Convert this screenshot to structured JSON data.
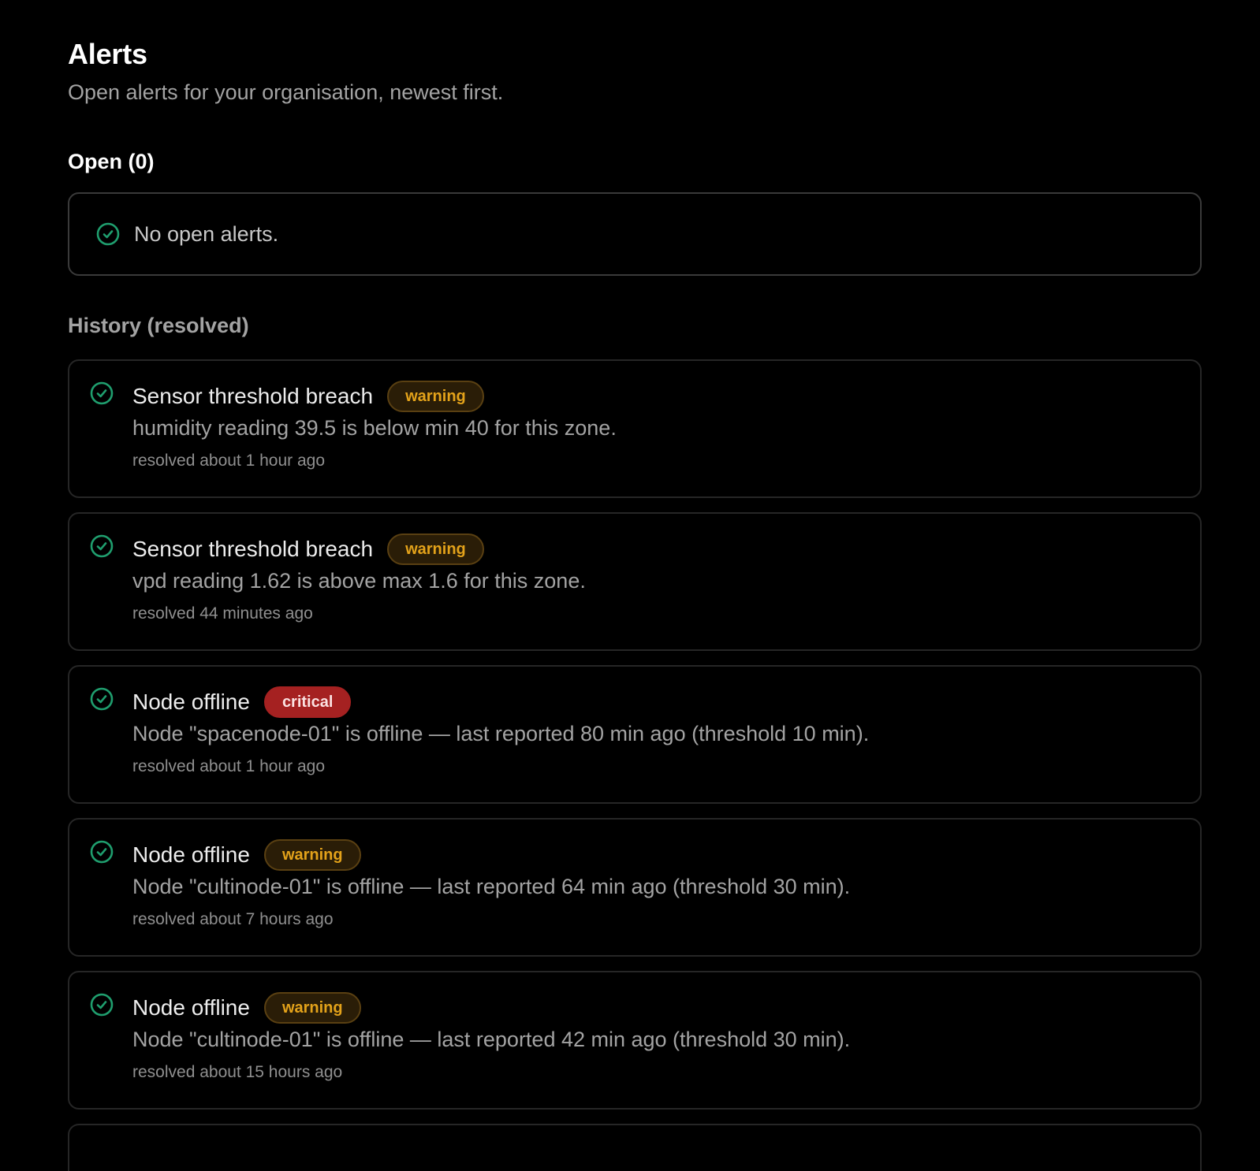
{
  "header": {
    "title": "Alerts",
    "subtitle": "Open alerts for your organisation, newest first."
  },
  "open": {
    "heading": "Open (0)",
    "empty_text": "No open alerts."
  },
  "history": {
    "heading": "History (resolved)",
    "items": [
      {
        "title": "Sensor threshold breach",
        "severity": "warning",
        "description": "humidity reading 39.5 is below min 40 for this zone.",
        "resolved": "resolved about 1 hour ago"
      },
      {
        "title": "Sensor threshold breach",
        "severity": "warning",
        "description": "vpd reading 1.62 is above max 1.6 for this zone.",
        "resolved": "resolved 44 minutes ago"
      },
      {
        "title": "Node offline",
        "severity": "critical",
        "description": "Node \"spacenode-01\" is offline — last reported 80 min ago (threshold 10 min).",
        "resolved": "resolved about 1 hour ago"
      },
      {
        "title": "Node offline",
        "severity": "warning",
        "description": "Node \"cultinode-01\" is offline — last reported 64 min ago (threshold 30 min).",
        "resolved": "resolved about 7 hours ago"
      },
      {
        "title": "Node offline",
        "severity": "warning",
        "description": "Node \"cultinode-01\" is offline — last reported 42 min ago (threshold 30 min).",
        "resolved": "resolved about 15 hours ago"
      }
    ]
  },
  "icons": {
    "resolved": "check-circle-icon"
  },
  "colors": {
    "background": "#000000",
    "success": "#1f9e6e",
    "warning": "#e3a21a",
    "critical": "#a52121"
  }
}
